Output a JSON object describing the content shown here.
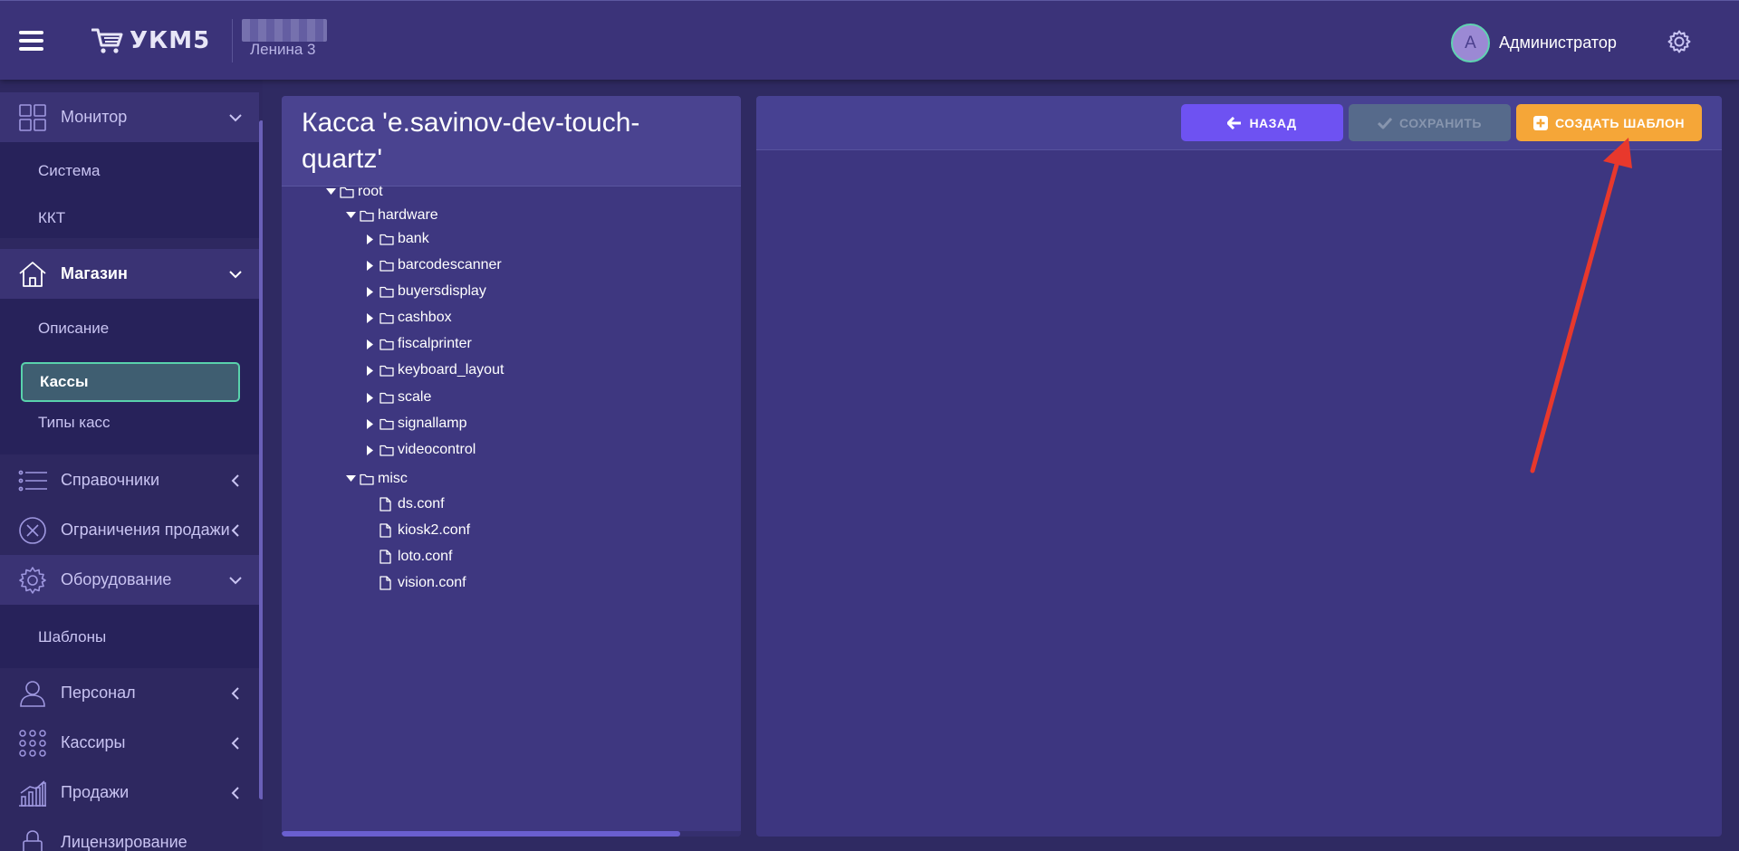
{
  "header": {
    "logo_text": "УКМ5",
    "shop_name": "Ленина 3",
    "user_initial": "А",
    "user_name": "Администратор"
  },
  "sidebar": {
    "monitor": {
      "label": "Монитор",
      "children": [
        "Система",
        "ККТ"
      ]
    },
    "shop": {
      "label": "Магазин",
      "children": [
        "Описание",
        "Кассы",
        "Типы касс"
      ],
      "selected": "Кассы"
    },
    "references": {
      "label": "Справочники"
    },
    "restrictions": {
      "label": "Ограничения продажи"
    },
    "equipment": {
      "label": "Оборудование",
      "children": [
        "Шаблоны"
      ]
    },
    "personnel": {
      "label": "Персонал"
    },
    "cashiers": {
      "label": "Кассиры"
    },
    "sales": {
      "label": "Продажи"
    },
    "licensing": {
      "label": "Лицензирование"
    }
  },
  "tree_panel": {
    "title": "Касса 'e.savinov-dev-touch-quartz'",
    "nodes": [
      {
        "label": "root"
      },
      {
        "label": "hardware"
      },
      {
        "label": "bank"
      },
      {
        "label": "barcodescanner"
      },
      {
        "label": "buyersdisplay"
      },
      {
        "label": "cashbox"
      },
      {
        "label": "fiscalprinter"
      },
      {
        "label": "keyboard_layout"
      },
      {
        "label": "scale"
      },
      {
        "label": "signallamp"
      },
      {
        "label": "videocontrol"
      },
      {
        "label": "misc"
      },
      {
        "label": "ds.conf"
      },
      {
        "label": "kiosk2.conf"
      },
      {
        "label": "loto.conf"
      },
      {
        "label": "vision.conf"
      }
    ]
  },
  "toolbar": {
    "back_label": "НАЗАД",
    "save_label": "СОХРАНИТЬ",
    "create_template_label": "СОЗДАТЬ ШАБЛОН"
  },
  "colors": {
    "background": "#2f2a62",
    "header": "#3b3379",
    "accent_purple": "#6e52f2",
    "accent_orange": "#f5a638",
    "selection_green": "#59d2ac",
    "annotation_red": "#e8382c"
  }
}
